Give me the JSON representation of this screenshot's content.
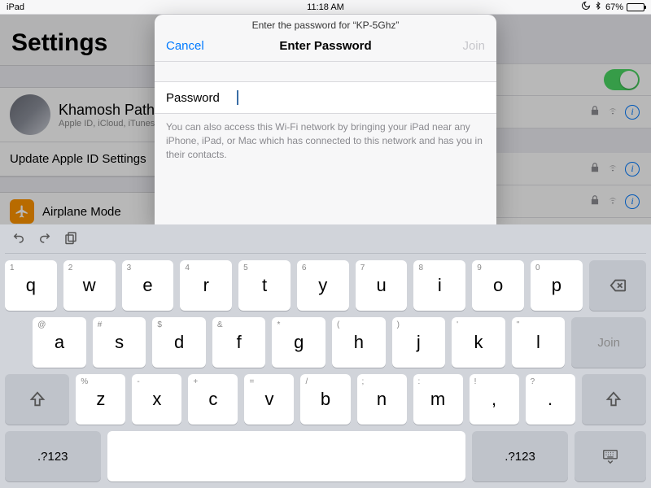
{
  "statusbar": {
    "device": "iPad",
    "time": "11:18 AM",
    "battery_pct": "67%",
    "battery_fill": 67
  },
  "sidebar": {
    "title": "Settings",
    "profile": {
      "name": "Khamosh Pathak",
      "sub": "Apple ID, iCloud, iTunes &"
    },
    "update": "Update Apple ID Settings",
    "airplane": "Airplane Mode"
  },
  "modal": {
    "prompt": "Enter the password for “KP-5Ghz”",
    "cancel": "Cancel",
    "title": "Enter Password",
    "join": "Join",
    "password_label": "Password",
    "hint": "You can also access this Wi-Fi network by bringing your iPad near any iPhone, iPad, or Mac which has connected to this network and has you in their contacts."
  },
  "keyboard": {
    "row1": [
      {
        "main": "q",
        "altl": "1"
      },
      {
        "main": "w",
        "altl": "2"
      },
      {
        "main": "e",
        "altl": "3"
      },
      {
        "main": "r",
        "altl": "4"
      },
      {
        "main": "t",
        "altl": "5"
      },
      {
        "main": "y",
        "altl": "6"
      },
      {
        "main": "u",
        "altl": "7"
      },
      {
        "main": "i",
        "altl": "8"
      },
      {
        "main": "o",
        "altl": "9"
      },
      {
        "main": "p",
        "altl": "0"
      }
    ],
    "row2": [
      {
        "main": "a",
        "altl": "@"
      },
      {
        "main": "s",
        "altl": "#"
      },
      {
        "main": "d",
        "altl": "$"
      },
      {
        "main": "f",
        "altl": "&"
      },
      {
        "main": "g",
        "altl": "*"
      },
      {
        "main": "h",
        "altl": "("
      },
      {
        "main": "j",
        "altl": ")"
      },
      {
        "main": "k",
        "altl": "'"
      },
      {
        "main": "l",
        "altl": "\""
      }
    ],
    "row3": [
      {
        "main": "z",
        "altl": "%"
      },
      {
        "main": "x",
        "altl": "-"
      },
      {
        "main": "c",
        "altl": "+"
      },
      {
        "main": "v",
        "altl": "="
      },
      {
        "main": "b",
        "altl": "/"
      },
      {
        "main": "n",
        "altl": ";"
      },
      {
        "main": "m",
        "altl": ":"
      },
      {
        "main": ",",
        "altl": "!"
      },
      {
        "main": ".",
        "altl": "?"
      }
    ],
    "numkey": ".?123",
    "join": "Join"
  }
}
